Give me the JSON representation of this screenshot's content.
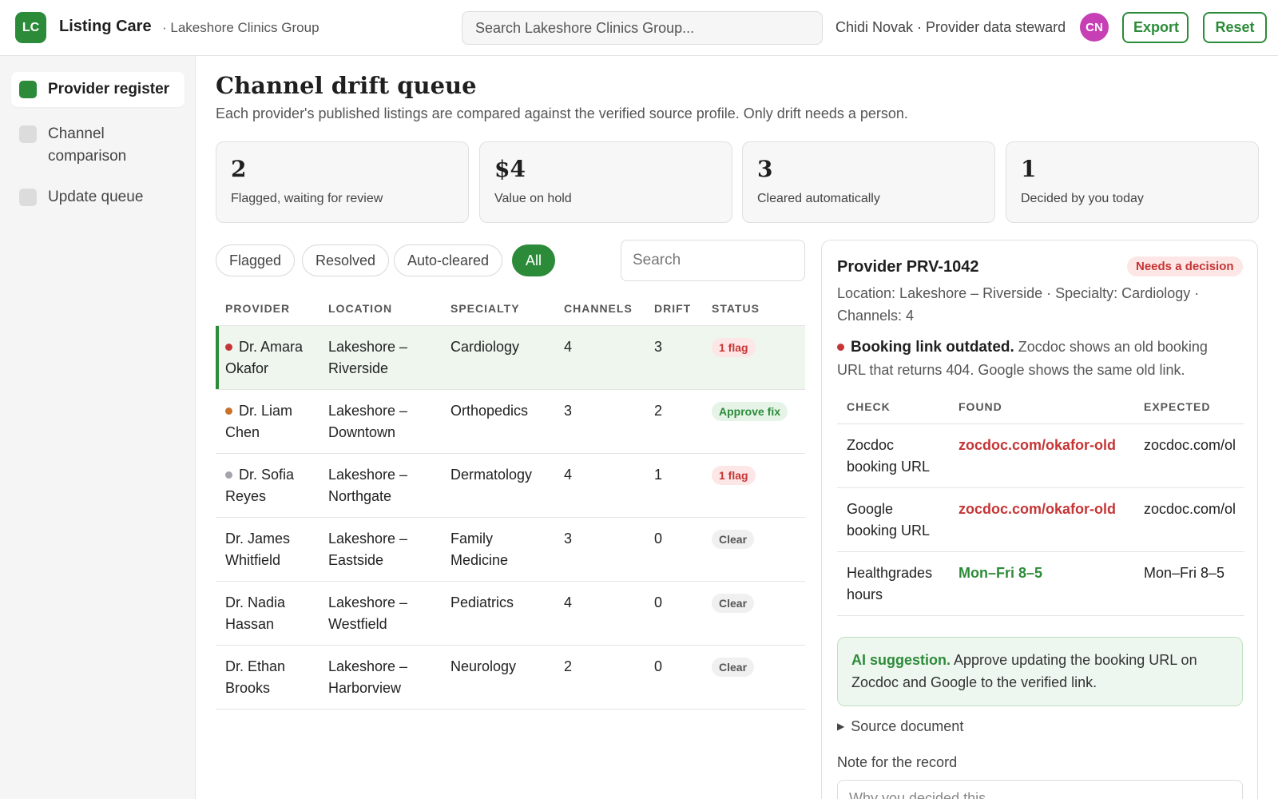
{
  "header": {
    "logo_text": "LC",
    "app_title": "Listing Care",
    "org": "· Lakeshore Clinics Group",
    "search_placeholder": "Search Lakeshore Clinics Group...",
    "user": "Chidi Novak · Provider data steward",
    "avatar_initials": "CN",
    "export_label": "Export",
    "reset_label": "Reset"
  },
  "sidebar": {
    "items": [
      {
        "label": "Provider register",
        "active": true
      },
      {
        "label": "Channel comparison",
        "active": false
      },
      {
        "label": "Update queue",
        "active": false
      }
    ]
  },
  "main": {
    "title": "Channel drift queue",
    "subtitle": "Each provider's published listings are compared against the verified source profile. Only drift needs a person.",
    "stats": [
      {
        "value": "2",
        "label": "Flagged, waiting for review"
      },
      {
        "value": "$4",
        "label": "Value on hold"
      },
      {
        "value": "3",
        "label": "Cleared automatically"
      },
      {
        "value": "1",
        "label": "Decided by you today"
      }
    ],
    "filters": [
      "Flagged",
      "Resolved",
      "Auto-cleared",
      "All"
    ],
    "active_filter": "All",
    "search_placeholder": "Search"
  },
  "table": {
    "headers": [
      "PROVIDER",
      "LOCATION",
      "SPECIALTY",
      "CHANNELS",
      "DRIFT",
      "STATUS"
    ],
    "rows": [
      {
        "provider": "Dr. Amara Okafor",
        "dot_color": "#c53535",
        "location": "Lakeshore – Riverside",
        "specialty": "Cardiology",
        "channels": "4",
        "drift": "3",
        "status": "1 flag",
        "status_type": "flag",
        "selected": true
      },
      {
        "provider": "Dr. Liam Chen",
        "dot_color": "#c9722a",
        "location": "Lakeshore – Downtown",
        "specialty": "Orthopedics",
        "channels": "3",
        "drift": "2",
        "status": "Approve fix",
        "status_type": "approve",
        "selected": false
      },
      {
        "provider": "Dr. Sofia Reyes",
        "dot_color": "#a3a3ad",
        "location": "Lakeshore – Northgate",
        "specialty": "Dermatology",
        "channels": "4",
        "drift": "1",
        "status": "1 flag",
        "status_type": "flag",
        "selected": false
      },
      {
        "provider": "Dr. James Whitfield",
        "dot_color": "",
        "location": "Lakeshore – Eastside",
        "specialty": "Family Medicine",
        "channels": "3",
        "drift": "0",
        "status": "Clear",
        "status_type": "clear",
        "selected": false
      },
      {
        "provider": "Dr. Nadia Hassan",
        "dot_color": "",
        "location": "Lakeshore – Westfield",
        "specialty": "Pediatrics",
        "channels": "4",
        "drift": "0",
        "status": "Clear",
        "status_type": "clear",
        "selected": false
      },
      {
        "provider": "Dr. Ethan Brooks",
        "dot_color": "",
        "location": "Lakeshore – Harborview",
        "specialty": "Neurology",
        "channels": "2",
        "drift": "0",
        "status": "Clear",
        "status_type": "clear",
        "selected": false
      }
    ]
  },
  "detail": {
    "title": "Provider PRV-1042",
    "badge": "Needs a decision",
    "meta": "Location: Lakeshore – Riverside · Specialty: Cardiology · Channels: 4",
    "issue_title": "Booking link outdated.",
    "issue_text": "Zocdoc shows an old booking URL that returns 404. Google shows the same old link.",
    "check_headers": [
      "CHECK",
      "FOUND",
      "EXPECTED"
    ],
    "checks": [
      {
        "check": "Zocdoc booking URL",
        "found": "zocdoc.com/okafor-old",
        "found_ok": false,
        "expected": "zocdoc.com/ol"
      },
      {
        "check": "Google booking URL",
        "found": "zocdoc.com/okafor-old",
        "found_ok": false,
        "expected": "zocdoc.com/ol"
      },
      {
        "check": "Healthgrades hours",
        "found": "Mon–Fri 8–5",
        "found_ok": true,
        "expected": "Mon–Fri 8–5"
      }
    ],
    "ai_title": "AI suggestion.",
    "ai_text": "Approve updating the booking URL on Zocdoc and Google to the verified link.",
    "source_doc": "Source document",
    "note_label": "Note for the record",
    "note_placeholder": "Why you decided this"
  },
  "colors": {
    "accent": "#2c8b39",
    "danger": "#c53535",
    "avatar": "#c73fb4"
  }
}
